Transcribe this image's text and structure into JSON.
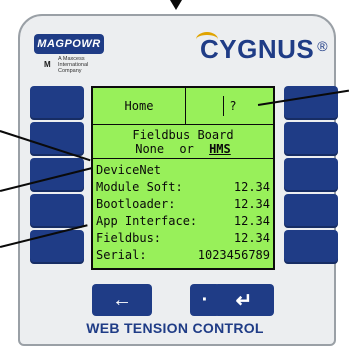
{
  "header": {
    "logo_text": "MAGPOWR",
    "logo_subtext": "A Maxcess International Company",
    "brand_text": "CYGNUS",
    "brand_reg": "®"
  },
  "screen": {
    "tab_home": "Home",
    "tab_help": "?",
    "title": "Fieldbus Board",
    "option_left": "None",
    "option_or": "or",
    "option_right": "HMS",
    "lines": [
      {
        "label": "DeviceNet",
        "value": ""
      },
      {
        "label": "Module Soft:",
        "value": "12.34"
      },
      {
        "label": "Bootloader:",
        "value": "12.34"
      },
      {
        "label": "App Interface:",
        "value": "12.34"
      },
      {
        "label": "Fieldbus:",
        "value": "12.34"
      },
      {
        "label": "Serial:",
        "value": "1023456789"
      }
    ]
  },
  "keypad": {
    "left_arrow": "←",
    "dot": "·",
    "enter": "↵"
  },
  "footer": {
    "text": "WEB TENSION CONTROL"
  },
  "colors": {
    "brand_blue": "#1f3c86",
    "screen_green": "#98f05a",
    "accent_gold": "#e0a400"
  }
}
